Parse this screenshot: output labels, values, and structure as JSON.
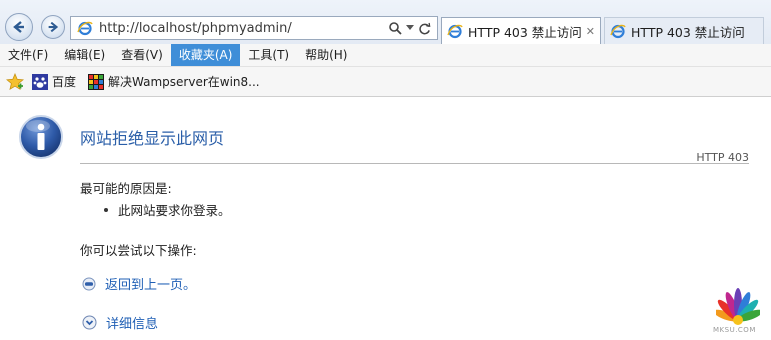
{
  "browser": {
    "url": "http://localhost/phpmyadmin/",
    "tabs": [
      {
        "label": "HTTP 403 禁止访问",
        "close": "✕"
      },
      {
        "label": "HTTP 403 禁止访问"
      }
    ],
    "menu": [
      "文件(F)",
      "编辑(E)",
      "查看(V)",
      "收藏夹(A)",
      "工具(T)",
      "帮助(H)"
    ],
    "menu_highlighted": "收藏夹(A)",
    "favorites": [
      {
        "label": "百度",
        "icon": "baidu-icon"
      },
      {
        "label": "解决Wampserver在win8...",
        "icon": "colorful-grid-icon"
      }
    ]
  },
  "page": {
    "title": "网站拒绝显示此网页",
    "code": "HTTP 403",
    "reason_heading": "最可能的原因是:",
    "reasons": [
      "此网站要求你登录。"
    ],
    "try_heading": "你可以尝试以下操作:",
    "actions": [
      {
        "label": "返回到上一页。",
        "icon": "back-bullet-icon"
      },
      {
        "label": "详细信息",
        "icon": "expand-chevron-icon"
      }
    ]
  },
  "watermark": {
    "text": "MKSU.COM"
  },
  "colors": {
    "link": "#1f5fb5",
    "title": "#2a5ea8",
    "menu_highlight": "#3f8ed8"
  }
}
